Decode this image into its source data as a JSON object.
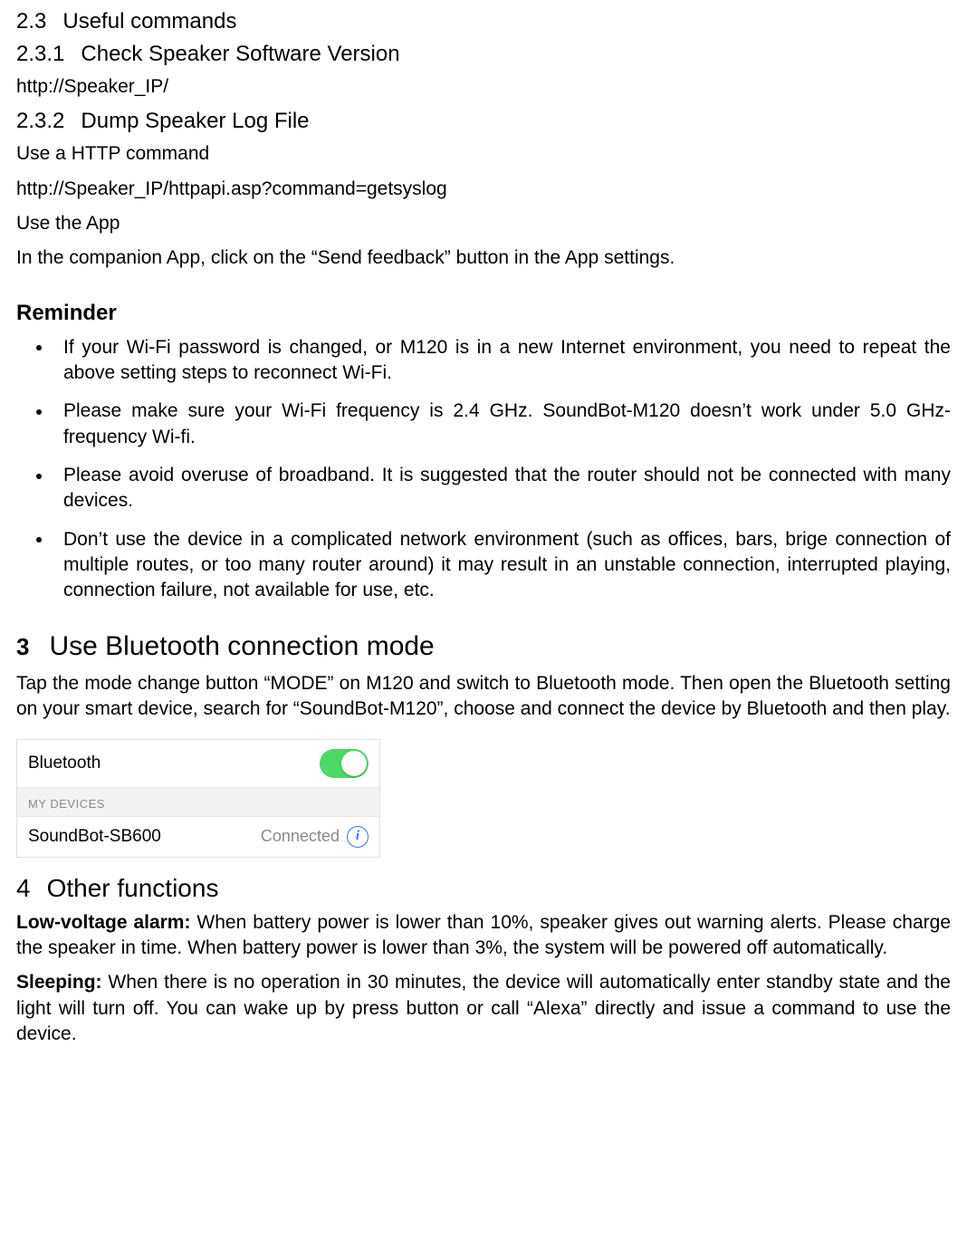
{
  "s23": {
    "num": "2.3",
    "title": "Useful commands"
  },
  "s231": {
    "num": "2.3.1",
    "title": "Check Speaker Software Version"
  },
  "s231_url": "http://Speaker_IP/",
  "s232": {
    "num": "2.3.2",
    "title": "Dump Speaker Log File"
  },
  "s232_p1": "Use a HTTP command",
  "s232_url": "http://Speaker_IP/httpapi.asp?command=getsyslog",
  "s232_p2": "Use the App",
  "s232_p3": "In the companion App, click on the “Send feedback” button in the App settings.",
  "reminder": {
    "heading": "Reminder",
    "items": [
      "If your Wi-Fi password is changed, or M120 is in a new Internet environment, you need to repeat the above setting steps to reconnect Wi-Fi.",
      "Please make sure your Wi-Fi frequency is 2.4 GHz. SoundBot-M120 doesn’t work under 5.0 GHz-frequency Wi-fi.",
      "Please avoid overuse of broadband. It is suggested that the router should not be connected with many devices.",
      "Don’t use the device in a complicated network environment (such as offices, bars, brige connection of multiple routes, or too many router around) it may result in an unstable connection, interrupted playing, connection failure, not available for use, etc."
    ]
  },
  "s3": {
    "num": "3",
    "title": "Use Bluetooth connection mode",
    "body": "Tap the mode change button “MODE” on M120 and switch to Bluetooth mode. Then open the Bluetooth setting on your smart device, search for “SoundBot-M120”, choose and connect the device by Bluetooth and then play."
  },
  "bt": {
    "label": "Bluetooth",
    "on": true,
    "section": "MY DEVICES",
    "device": "SoundBot-SB600",
    "status": "Connected",
    "info_glyph": "i"
  },
  "s4": {
    "num": "4",
    "title": "Other functions",
    "low_label": "Low-voltage alarm: ",
    "low_body": "When battery power is lower than 10%, speaker gives out warning alerts. Please charge the speaker in time. When battery power is lower than 3%, the system will be powered off automatically.",
    "sleep_label": "Sleeping: ",
    "sleep_body": "When there is no operation in 30 minutes, the device will automatically enter standby state and the light will turn off. You can wake up by press button or call “Alexa” directly and issue a command to use the device."
  }
}
